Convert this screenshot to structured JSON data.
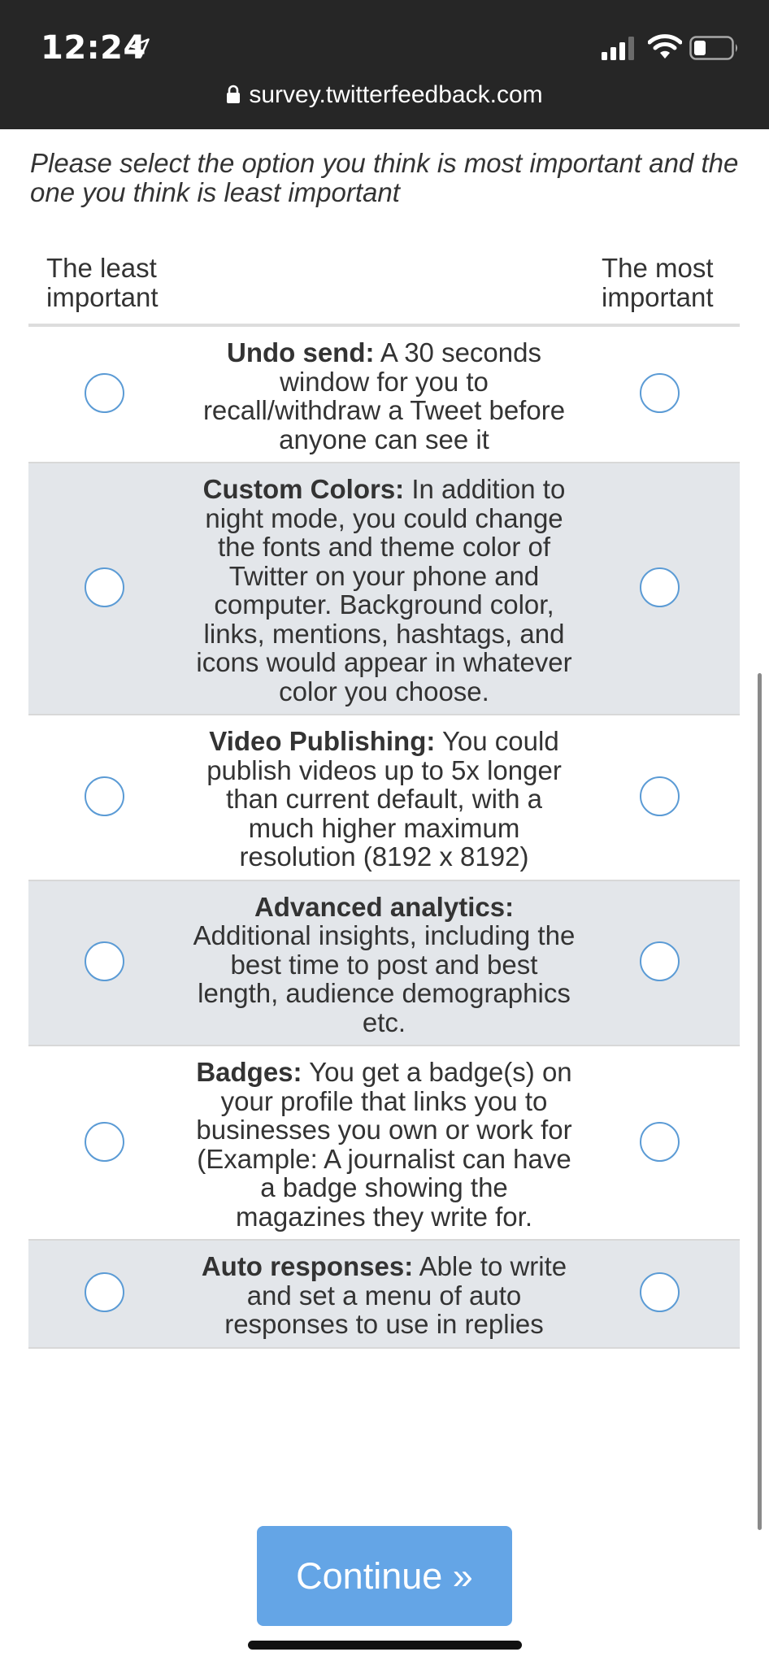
{
  "status_bar": {
    "time": "12:24",
    "icons": [
      "location-arrow-icon",
      "signal-icon",
      "wifi-icon",
      "battery-icon"
    ]
  },
  "browser": {
    "url": "survey.twitterfeedback.com"
  },
  "survey": {
    "instructions": "Please select the option you think is most important and the one you think is least important",
    "column_least": "The least important",
    "column_most": "The most important",
    "options": [
      {
        "title": "Undo send:",
        "description": "A 30 seconds window for you to recall/withdraw a Tweet before anyone can see it",
        "least_selected": false,
        "most_selected": false
      },
      {
        "title": "Custom Colors:",
        "description": "In addition to night mode, you could change the fonts and theme color of Twitter on your phone and computer. Background color, links, mentions, hashtags, and icons would appear in whatever color you choose.",
        "least_selected": false,
        "most_selected": false
      },
      {
        "title": "Video Publishing:",
        "description": "You could publish videos up to 5x longer than current default, with a much higher maximum resolution (8192 x 8192)",
        "least_selected": false,
        "most_selected": false
      },
      {
        "title": "Advanced analytics:",
        "description": "Additional insights, including the best time to post and best length, audience demographics etc.",
        "least_selected": false,
        "most_selected": false
      },
      {
        "title": "Badges:",
        "description": "You get a badge(s) on your profile that links you to businesses you own or work for (Example: A journalist can have a badge showing the magazines they write for.",
        "least_selected": false,
        "most_selected": false
      },
      {
        "title": "Auto responses:",
        "description": "Able to write and set a menu of auto responses to use in replies",
        "least_selected": false,
        "most_selected": false
      }
    ],
    "continue_label": "Continue »"
  },
  "colors": {
    "top_bar": "#262626",
    "radio_border": "#5b9bd5",
    "alt_row": "#e3e6ea",
    "button": "#64a5e6"
  }
}
